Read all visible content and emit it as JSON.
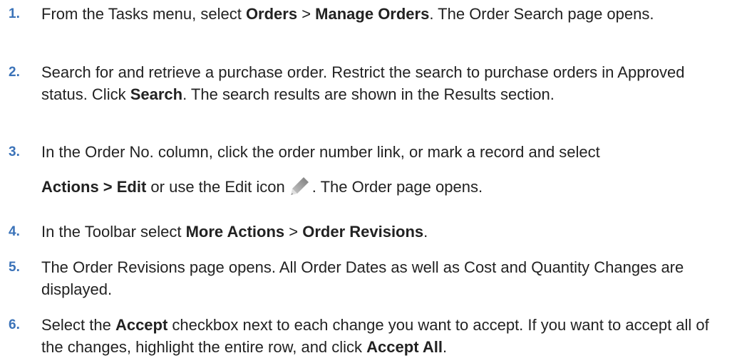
{
  "steps": [
    {
      "number": "1.",
      "t1": "From the Tasks menu, select ",
      "b1": "Orders",
      "t2": " > ",
      "b2": "Manage Orders",
      "t3": ". The Order Search page opens."
    },
    {
      "number": "2.",
      "t1": "Search for and retrieve a purchase order. Restrict the search to purchase orders in Approved status. Click ",
      "b1": "Search",
      "t2": ". The search results are shown in the Results section."
    },
    {
      "number": "3.",
      "t1": "In the Order No. column, click the order number link, or mark a record and select",
      "b1": "Actions > Edit",
      "t2": " or use the Edit icon",
      "icon": "pencil-icon",
      "t3": ". The Order page opens."
    },
    {
      "number": "4.",
      "t1": "In the Toolbar select ",
      "b1": "More Actions",
      "t2": " > ",
      "b2": "Order Revisions",
      "t3": "."
    },
    {
      "number": "5.",
      "t1": "The Order Revisions page opens. All Order Dates as well as Cost and Quantity Changes are displayed."
    },
    {
      "number": "6.",
      "t1": "Select the ",
      "b1": "Accept",
      "t2": " checkbox next to each change you want to accept. If you want to accept all of the changes, highlight the entire row, and click ",
      "b2": "Accept All",
      "t3": "."
    }
  ],
  "colors": {
    "step_number": "#3a72b8",
    "text": "#222222",
    "icon": "#9a9a9a"
  }
}
